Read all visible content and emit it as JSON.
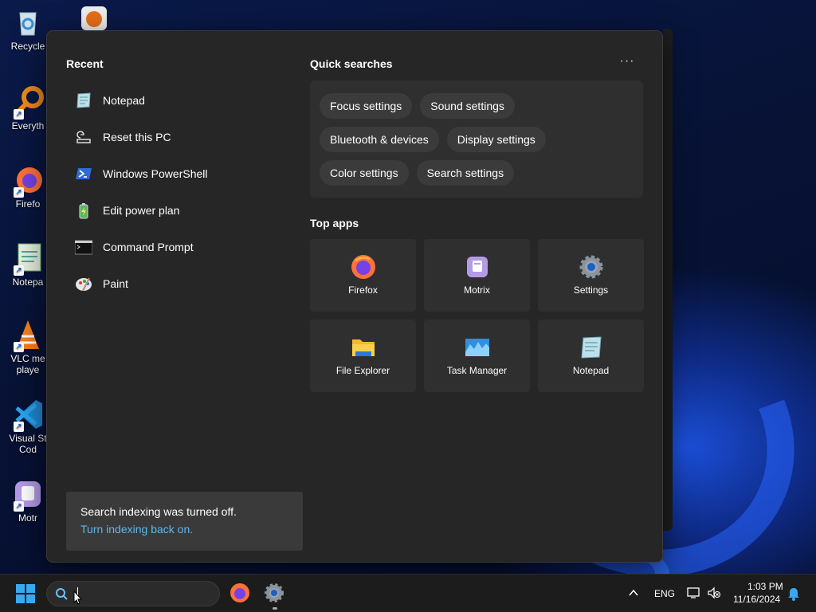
{
  "desktop": {
    "icons": [
      {
        "label": "Recycle",
        "icon": "recycle-bin-icon"
      },
      {
        "label": "Everyth",
        "icon": "everything-search-icon"
      },
      {
        "label": "Firefo",
        "icon": "firefox-icon"
      },
      {
        "label": "Notepa",
        "icon": "notepad-icon"
      },
      {
        "label": "VLC me\nplaye",
        "icon": "vlc-icon"
      },
      {
        "label": "Visual St\nCod",
        "icon": "vscode-icon"
      },
      {
        "label": "Motr",
        "icon": "motrix-icon"
      }
    ]
  },
  "panel": {
    "recent_title": "Recent",
    "recent": [
      {
        "label": "Notepad",
        "icon": "notepad-icon"
      },
      {
        "label": "Reset this PC",
        "icon": "reset-pc-icon"
      },
      {
        "label": "Windows PowerShell",
        "icon": "powershell-icon"
      },
      {
        "label": "Edit power plan",
        "icon": "battery-icon"
      },
      {
        "label": "Command Prompt",
        "icon": "cmd-icon"
      },
      {
        "label": "Paint",
        "icon": "paint-icon"
      }
    ],
    "quick_searches_title": "Quick searches",
    "more_label": "···",
    "chips": [
      [
        "Focus settings",
        "Sound settings"
      ],
      [
        "Bluetooth & devices",
        "Display settings"
      ],
      [
        "Color settings",
        "Search settings"
      ]
    ],
    "top_apps_title": "Top apps",
    "top_apps": [
      {
        "label": "Firefox",
        "icon": "firefox-icon"
      },
      {
        "label": "Motrix",
        "icon": "motrix-icon"
      },
      {
        "label": "Settings",
        "icon": "gear-icon"
      },
      {
        "label": "File Explorer",
        "icon": "folder-icon"
      },
      {
        "label": "Task Manager",
        "icon": "task-manager-icon"
      },
      {
        "label": "Notepad",
        "icon": "notepad-icon"
      }
    ],
    "notice": {
      "text": "Search indexing was turned off.",
      "link": "Turn indexing back on."
    }
  },
  "taskbar": {
    "search_value": "",
    "language": "ENG",
    "time": "1:03 PM",
    "date": "11/16/2024"
  },
  "colors": {
    "accent_link": "#60b6f0",
    "panel_bg": "#262626",
    "tile_bg": "#2f2f2f"
  }
}
